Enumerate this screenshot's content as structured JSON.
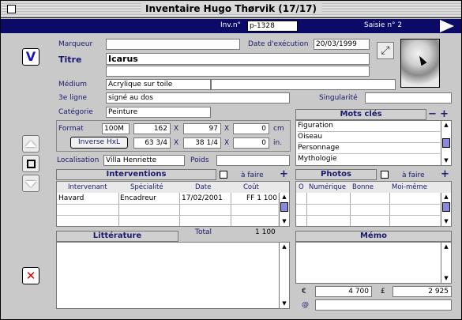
{
  "window": {
    "title": "Inventaire Hugo Thørvik (17/17)"
  },
  "nav": {
    "inv_label": "Inv.n°",
    "inv_value": "p-1328",
    "saisie": "Saisie n° 2"
  },
  "form": {
    "marqueur_label": "Marqueur",
    "marqueur_value": "",
    "date_label": "Date d'exécution",
    "date_value": "20/03/1999",
    "titre_label": "Titre",
    "titre_value": "Icarus",
    "medium_label": "Médium",
    "medium_value": "Acrylique sur toile",
    "ligne3_label": "3e ligne",
    "ligne3_value": "signé au dos",
    "singularite_label": "Singularité",
    "singularite_value": "",
    "categorie_label": "Catégorie",
    "categorie_value": "Peinture",
    "format_label": "Format",
    "format_code": "100M",
    "dim_cm": [
      "162",
      "97",
      "0"
    ],
    "unit_cm": "cm",
    "inverse_label": "Inverse HxL",
    "dim_in": [
      "63 3/4",
      "38 1/4",
      "0"
    ],
    "unit_in": "in.",
    "x_sep": "X",
    "localisation_label": "Localisation",
    "localisation_value": "Villa Henriette",
    "poids_label": "Poids",
    "poids_value": ""
  },
  "motscles": {
    "header": "Mots clés",
    "items": [
      "Figuration",
      "Oiseau",
      "Personnage",
      "Mythologie"
    ]
  },
  "interventions": {
    "header": "Interventions",
    "afaire": "à faire",
    "columns": [
      "Intervenant",
      "Spécialité",
      "Date",
      "Coût"
    ],
    "rows": [
      [
        "Havard",
        "Encadreur",
        "17/02/2001",
        "FF 1 100"
      ]
    ],
    "total_label": "Total",
    "total_value": "1 100"
  },
  "photos": {
    "header": "Photos",
    "afaire": "à faire",
    "columns": [
      "O",
      "Numérique",
      "Bonne",
      "Moi-même"
    ]
  },
  "litterature": {
    "header": "Littérature"
  },
  "memo": {
    "header": "Mémo"
  },
  "prices": {
    "euro_symbol": "€",
    "euro_value": "4 700",
    "pound_symbol": "£",
    "pound_value": "2 925",
    "at_symbol": "@",
    "at_value": ""
  },
  "buttons": {
    "validate": "V",
    "delete": "✕"
  },
  "colors": {
    "navbar": "#0b0a66",
    "accent_blue": "#1a1a6e",
    "delete_red": "#e00000"
  }
}
